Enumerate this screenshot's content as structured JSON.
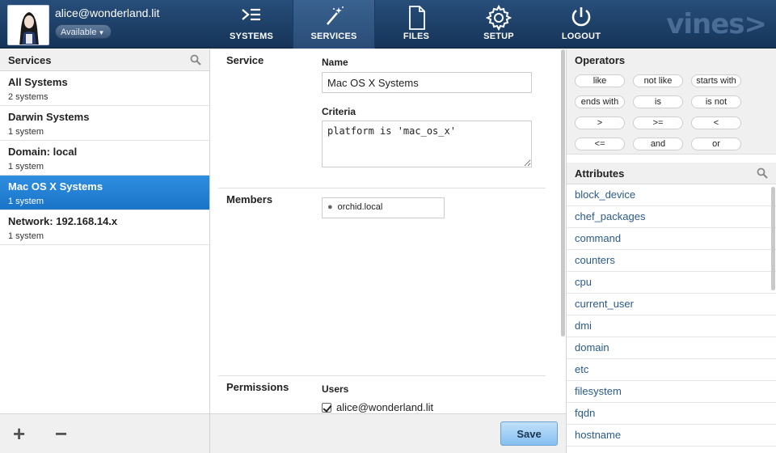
{
  "header": {
    "user": "alice@wonderland.lit",
    "status": "Available",
    "brand": "vines>",
    "nav": [
      {
        "label": "SYSTEMS",
        "icon": "systems-icon"
      },
      {
        "label": "SERVICES",
        "icon": "wand-icon",
        "active": true
      },
      {
        "label": "FILES",
        "icon": "file-icon"
      },
      {
        "label": "SETUP",
        "icon": "gear-icon"
      },
      {
        "label": "LOGOUT",
        "icon": "power-icon"
      }
    ]
  },
  "services_panel": {
    "title": "Services",
    "items": [
      {
        "title": "All Systems",
        "count": "2 systems"
      },
      {
        "title": "Darwin Systems",
        "count": "1 system"
      },
      {
        "title": "Domain: local",
        "count": "1 system"
      },
      {
        "title": "Mac OS X Systems",
        "count": "1 system",
        "selected": true
      },
      {
        "title": "Network: 192.168.14.x",
        "count": "1 system"
      }
    ],
    "add_label": "+",
    "remove_label": "−"
  },
  "form": {
    "service_label": "Service",
    "name_label": "Name",
    "name_value": "Mac OS X Systems",
    "criteria_label": "Criteria",
    "criteria_value": "platform is 'mac_os_x'",
    "members_label": "Members",
    "members": [
      "orchid.local"
    ],
    "permissions_label": "Permissions",
    "users_label": "Users",
    "users": [
      "alice@wonderland.lit"
    ],
    "save_label": "Save"
  },
  "operators_panel": {
    "title": "Operators",
    "ops": [
      "like",
      "not like",
      "starts with",
      "ends with",
      "is",
      "is not",
      ">",
      ">=",
      "<",
      "<=",
      "and",
      "or"
    ]
  },
  "attributes_panel": {
    "title": "Attributes",
    "items": [
      "block_device",
      "chef_packages",
      "command",
      "counters",
      "cpu",
      "current_user",
      "dmi",
      "domain",
      "etc",
      "filesystem",
      "fqdn",
      "hostname"
    ]
  },
  "colors": {
    "header_bg": "#1e416a",
    "selected": "#2582d6",
    "link": "#2a5a8a"
  }
}
